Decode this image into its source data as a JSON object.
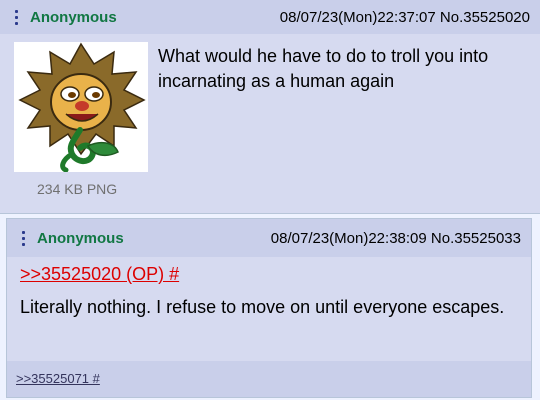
{
  "posts": [
    {
      "name": "Anonymous",
      "datetime": "08/07/23(Mon)22:37:07",
      "number": "No.35525020",
      "file_size": "234 KB PNG",
      "thumbnail_icon": "lion-flower-icon",
      "text": "What would he have to do to troll you into incarnating as a human again"
    },
    {
      "name": "Anonymous",
      "datetime": "08/07/23(Mon)22:38:09",
      "number": "No.35525033",
      "quote": ">>35525020 (OP) #",
      "text": "Literally nothing. I refuse to move on until everyone escapes."
    }
  ],
  "replies": {
    "backlink": ">>35525071 #"
  },
  "colors": {
    "post_bg": "#d6daf0",
    "header_bg": "#c9cfea",
    "name": "#117743",
    "quote_link": "#dd0000",
    "backlink": "#34345c"
  }
}
